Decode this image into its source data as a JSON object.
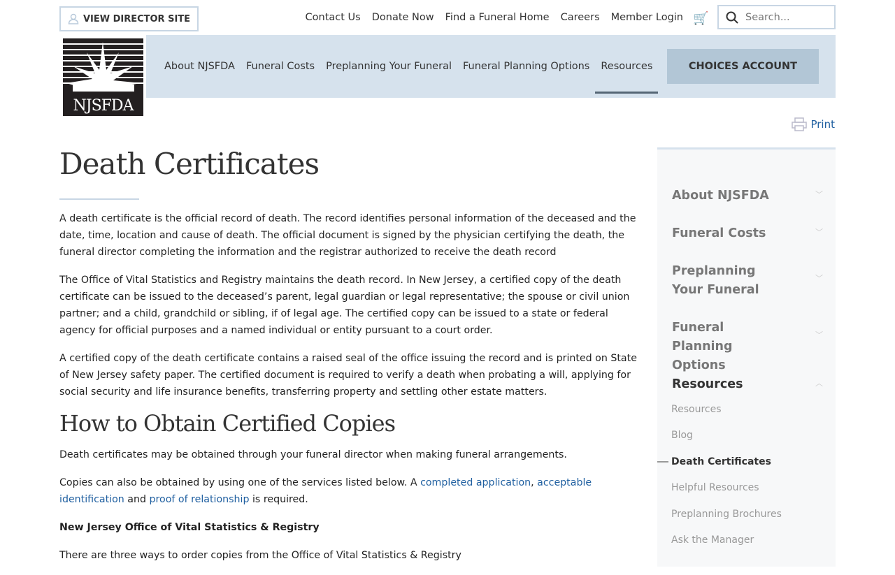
{
  "header": {
    "director_site": "VIEW DIRECTOR SITE",
    "utility": [
      "Contact Us",
      "Donate Now",
      "Find a Funeral Home",
      "Careers",
      "Member Login"
    ],
    "search_placeholder": "Search...",
    "logo_text": "NJSFDA"
  },
  "nav": {
    "items": [
      "About NJSFDA",
      "Funeral Costs",
      "Preplanning Your Funeral",
      "Funeral Planning Options",
      "Resources"
    ],
    "active": "Resources",
    "choices": "CHOICES ACCOUNT"
  },
  "print": "Print",
  "page": {
    "title": "Death Certificates",
    "p1": "A death certificate is the official record of death. The record identifies personal information of the deceased and the date, time, location and cause of death. The official document is signed by the physician certifying the death, the funeral director completing the information and the registrar authorized to receive the death record",
    "p2": "The Office of Vital Statistics and Registry maintains the death record. In New Jersey, a certified copy of the death certificate can be issued to the deceased’s parent, legal guardian or legal representative; the spouse or civil union partner; and a child, grandchild or sibling, if of legal age. The certified copy can be issued to a state or federal agency for official purposes and a named individual or entity pursuant to a court order.",
    "p3": "A certified copy of the death certificate contains a raised seal of the office issuing the record and is printed on State of New Jersey safety paper. The certified document is required to verify a death when probating a will, applying for social security and life insurance benefits, transferring property and settling other estate matters.",
    "h2": "How to Obtain Certified Copies",
    "p4": "Death certificates may be obtained through your funeral director when making funeral arrangements.",
    "p5a": "Copies can also be obtained by using one of the services listed below. A ",
    "link1": "completed application",
    "sep": ", ",
    "link2": "acceptable identification",
    "and": " and ",
    "link3": "proof of relationship",
    "p5b": " is required.",
    "bold": "New Jersey Office of Vital Statistics & Registry",
    "p6": "There are three ways to order copies from the Office of Vital Statistics & Registry"
  },
  "sidebar": {
    "main": [
      "About NJSFDA",
      "Funeral Costs",
      "Preplanning Your Funeral",
      "Funeral Planning Options",
      "Resources"
    ],
    "sub": [
      "Resources",
      "Blog",
      "Death Certificates",
      "Helpful Resources",
      "Preplanning Brochures",
      "Ask the Manager"
    ],
    "current": "Death Certificates"
  }
}
